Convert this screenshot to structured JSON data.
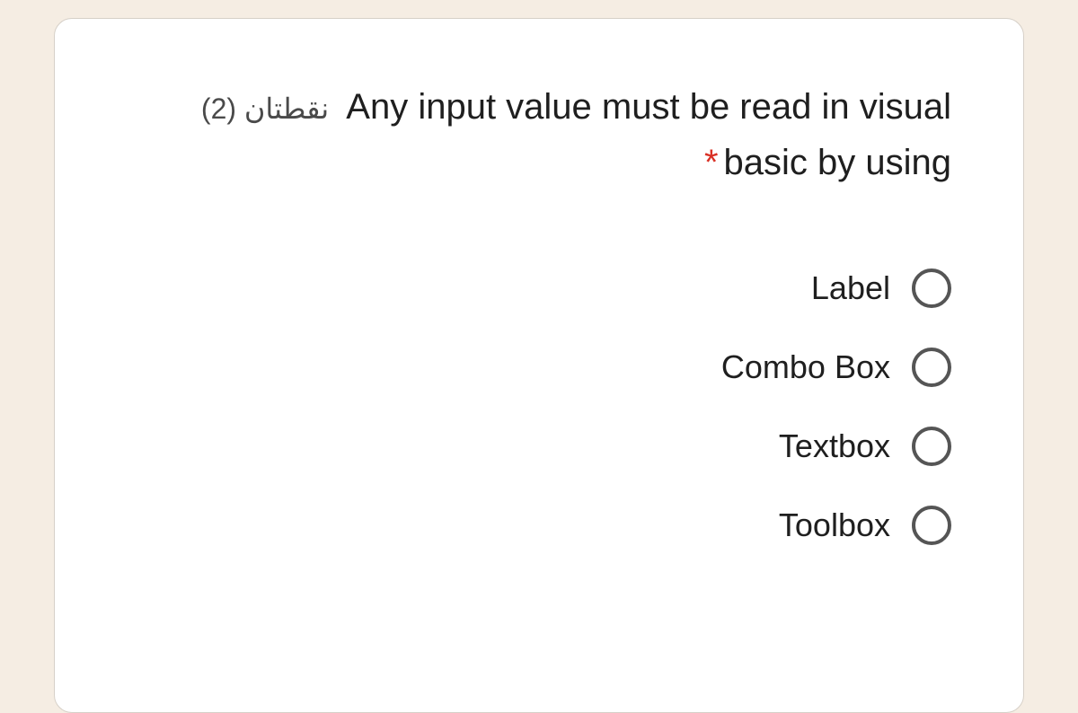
{
  "question": {
    "points_label": "نقطتان (2)",
    "line1_text": "Any input value must be read in visual",
    "line2_text": "basic by using",
    "required_marker": "*"
  },
  "options": [
    {
      "label": "Label"
    },
    {
      "label": "Combo Box"
    },
    {
      "label": "Textbox"
    },
    {
      "label": "Toolbox"
    }
  ]
}
